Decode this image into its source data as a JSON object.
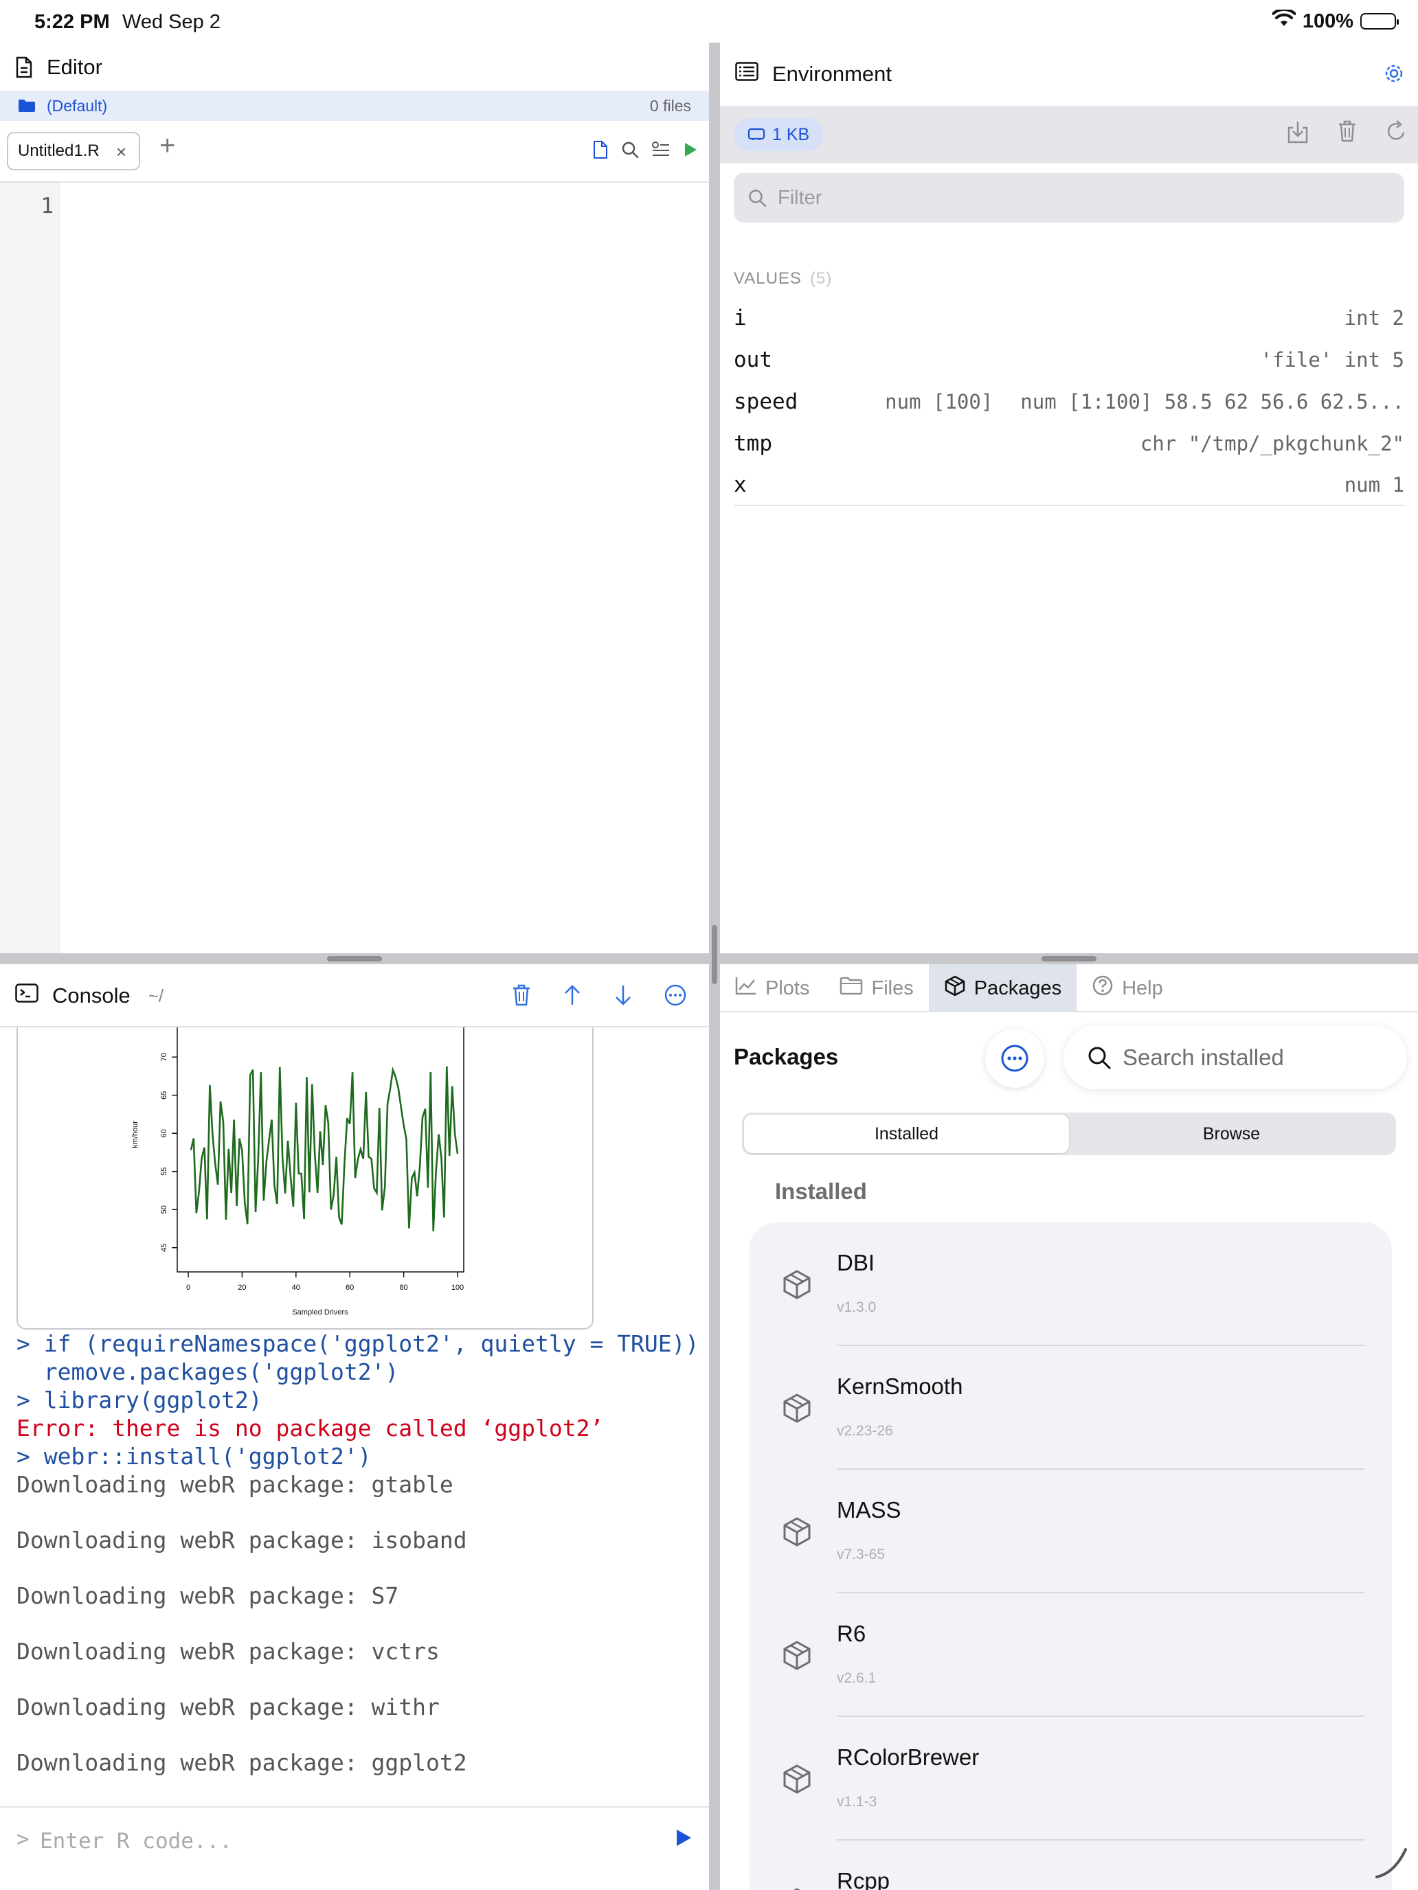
{
  "status_bar": {
    "time": "5:22 PM",
    "date": "Wed Sep 2",
    "battery": "100%"
  },
  "editor": {
    "title": "Editor",
    "project": {
      "name": "(Default)",
      "file_count": "0 files"
    },
    "tab": {
      "label": "Untitled1.R",
      "close": "×",
      "add": "+"
    },
    "line_numbers": [
      "1"
    ]
  },
  "console": {
    "title": "Console",
    "path": "~/",
    "prompt": ">",
    "input_placeholder": "Enter R code...",
    "plot": {
      "ylabel": "km/hour",
      "xlabel": "Sampled Drivers",
      "x_ticks": [
        "0",
        "20",
        "40",
        "60",
        "80",
        "100"
      ],
      "y_ticks": [
        "45",
        "50",
        "55",
        "60",
        "65",
        "70"
      ]
    },
    "lines": [
      {
        "type": "input",
        "text": "> if (requireNamespace('ggplot2', quietly = TRUE))"
      },
      {
        "type": "input",
        "text": "  remove.packages('ggplot2')"
      },
      {
        "type": "input",
        "text": "> library(ggplot2)"
      },
      {
        "type": "error",
        "text": "Error: there is no package called ‘ggplot2’"
      },
      {
        "type": "input",
        "text": "> webr::install('ggplot2')"
      },
      {
        "type": "output",
        "text": "Downloading webR package: gtable"
      },
      {
        "type": "output",
        "text": "Downloading webR package: isoband"
      },
      {
        "type": "output",
        "text": "Downloading webR package: S7"
      },
      {
        "type": "output",
        "text": "Downloading webR package: vctrs"
      },
      {
        "type": "output",
        "text": "Downloading webR package: withr"
      },
      {
        "type": "output",
        "text": "Downloading webR package: ggplot2"
      }
    ]
  },
  "environment": {
    "title": "Environment",
    "memory": "1 KB",
    "filter_placeholder": "Filter",
    "values_label": "VALUES",
    "values_count": "(5)",
    "values": [
      {
        "name": "i",
        "info": "",
        "value": "int 2"
      },
      {
        "name": "out",
        "info": "",
        "value": "'file' int 5"
      },
      {
        "name": "speed",
        "info": "num [100]",
        "value": "num [1:100] 58.5 62 56.6 62.5..."
      },
      {
        "name": "tmp",
        "info": "",
        "value": "chr \"/tmp/_pkgchunk_2\""
      },
      {
        "name": "x",
        "info": "",
        "value": "num 1"
      }
    ]
  },
  "bottom_tabs": [
    {
      "label": "Plots",
      "icon": "chart-line-icon",
      "active": false
    },
    {
      "label": "Files",
      "icon": "folder-icon",
      "active": false
    },
    {
      "label": "Packages",
      "icon": "cube-icon",
      "active": true
    },
    {
      "label": "Help",
      "icon": "question-circle-icon",
      "active": false
    }
  ],
  "packages": {
    "title": "Packages",
    "search_placeholder": "Search installed",
    "segments": [
      "Installed",
      "Browse"
    ],
    "active_segment": "Installed",
    "section_heading": "Installed",
    "items": [
      {
        "name": "DBI",
        "version": "v1.3.0"
      },
      {
        "name": "KernSmooth",
        "version": "v2.23-26"
      },
      {
        "name": "MASS",
        "version": "v7.3-65"
      },
      {
        "name": "R6",
        "version": "v2.6.1"
      },
      {
        "name": "RColorBrewer",
        "version": "v1.1-3"
      },
      {
        "name": "Rcpp",
        "version": ""
      }
    ]
  },
  "colors": {
    "accent": "#1a53d6",
    "error": "#d0021b",
    "console_input": "#1f4fa0",
    "plot_line": "#1e6b1e"
  }
}
